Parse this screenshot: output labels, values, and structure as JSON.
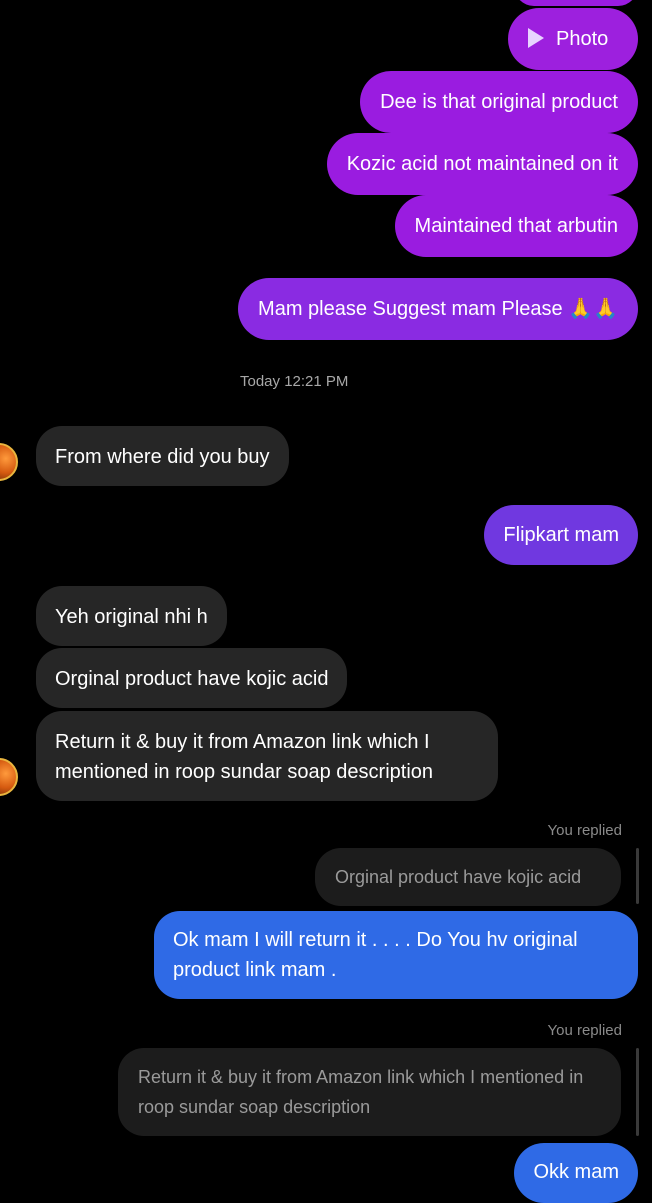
{
  "colors": {
    "background": "#000000",
    "sent_purple": "#9a1ce0",
    "sent_violet": "#7038e0",
    "sent_blue": "#2f6ae6",
    "received": "#262626",
    "quote": "#1c1c1c"
  },
  "messages_top": {
    "photo_label": "Photo",
    "photo_icon": "play-icon",
    "msg_original_product": "Dee is that original product",
    "msg_kozic_acid": "Kozic acid not maintained on it",
    "msg_arbutin": "Maintained that arbutin",
    "msg_suggest": "Mam please Suggest mam Please 🙏🙏"
  },
  "timestamp": "Today 12:21 PM",
  "conversation": {
    "received_where_buy": "From where did you buy",
    "sent_flipkart": "Flipkart mam",
    "received_not_original": "Yeh original nhi h",
    "received_kojic": "Orginal product have kojic acid",
    "received_return": "Return it & buy it from Amazon link which I mentioned in roop sundar soap description"
  },
  "reply_1": {
    "label": "You replied",
    "quoted": "Orginal product have kojic acid",
    "message": "Ok mam I will return it . . . . Do You hv original product link mam ."
  },
  "reply_2": {
    "label": "You replied",
    "quoted": "Return it & buy it from Amazon link which I mentioned in roop sundar soap description",
    "message": "Okk mam"
  }
}
